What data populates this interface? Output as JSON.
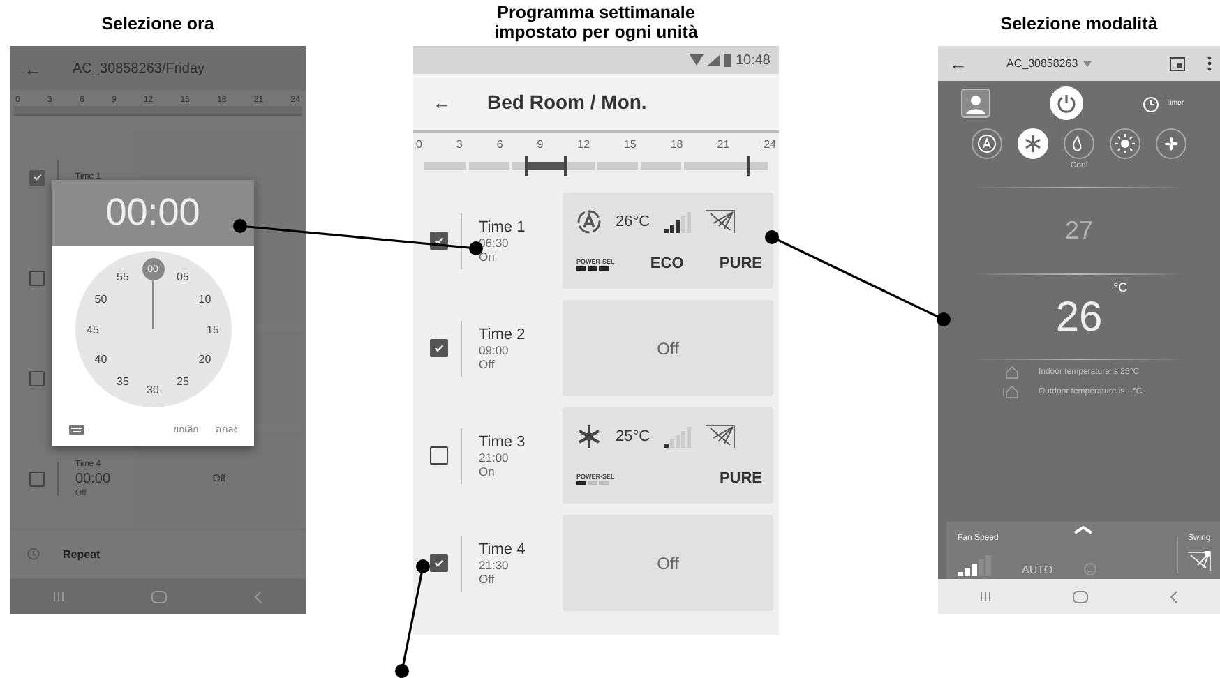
{
  "time_picker_screen": {
    "caption": "Selezione ora",
    "back": "←",
    "title": "AC_30858263/Friday",
    "ticks": [
      "0",
      "3",
      "6",
      "9",
      "12",
      "15",
      "18",
      "21",
      "24"
    ],
    "rows": [
      {
        "checked": true,
        "name": "Time 1"
      },
      {
        "checked": false
      },
      {
        "checked": false
      },
      {
        "checked": false,
        "name": "Time 4",
        "time": "00:00",
        "state": "Off",
        "setting": "Off"
      }
    ],
    "repeat": "Repeat",
    "dialog": {
      "time": "00:00",
      "minutes": [
        {
          "label": "00",
          "selected": true
        },
        {
          "label": "05",
          "selected": false
        },
        {
          "label": "10",
          "selected": false
        },
        {
          "label": "15",
          "selected": false
        },
        {
          "label": "20",
          "selected": false
        },
        {
          "label": "25",
          "selected": false
        },
        {
          "label": "30",
          "selected": false
        },
        {
          "label": "35",
          "selected": false
        },
        {
          "label": "40",
          "selected": false
        },
        {
          "label": "45",
          "selected": false
        },
        {
          "label": "50",
          "selected": false
        },
        {
          "label": "55",
          "selected": false
        }
      ],
      "cancel": "ยกเลิก",
      "ok": "ตกลง"
    }
  },
  "schedule_screen": {
    "caption": "Programma settimanale impostato per ogni unità",
    "status_time": "10:48",
    "back": "←",
    "title": "Bed Room / Mon.",
    "ticks": [
      "0",
      "3",
      "6",
      "9",
      "12",
      "15",
      "18",
      "21",
      "24"
    ],
    "rows": [
      {
        "checked": true,
        "name": "Time 1",
        "time": "06:30",
        "state": "On",
        "setting": {
          "kind": "program",
          "mode_icon": {
            "kind": "auto"
          },
          "temperature": "26°C",
          "fan": {
            "level": 0.6
          },
          "power_sel": {
            "label": "POWER-SEL",
            "level": 1
          },
          "options": [
            "ECO",
            "PURE"
          ]
        }
      },
      {
        "checked": true,
        "name": "Time 2",
        "time": "09:00",
        "state": "Off",
        "setting": {
          "kind": "off",
          "label": "Off"
        }
      },
      {
        "checked": false,
        "name": "Time 3",
        "time": "21:00",
        "state": "On",
        "setting": {
          "kind": "program",
          "mode_icon": {
            "kind": "cool"
          },
          "temperature": "25°C",
          "fan": {
            "level": 0.2
          },
          "power_sel": {
            "label": "POWER-SEL",
            "level": 0.33
          },
          "options": [
            "PURE"
          ]
        }
      },
      {
        "checked": true,
        "name": "Time 4",
        "time": "21:30",
        "state": "Off",
        "setting": {
          "kind": "off",
          "label": "Off"
        }
      }
    ]
  },
  "mode_screen": {
    "caption": "Selezione modalità",
    "back": "←",
    "title": "AC_30858263",
    "timer": "Timer",
    "modes": [
      {
        "kind": "auto",
        "selected": false
      },
      {
        "kind": "cool",
        "selected": true
      },
      {
        "kind": "dry",
        "selected": false
      },
      {
        "kind": "heat",
        "selected": false
      },
      {
        "kind": "fan",
        "selected": false
      }
    ],
    "mode_label": "Cool",
    "temp_above": "27",
    "temperature": "26",
    "unit": "°C",
    "indoor": "Indoor temperature is 25°C",
    "outdoor": "Outdoor temperature is --°C",
    "fan_speed": {
      "label": "Fan Speed",
      "level": 0.6,
      "value": "AUTO"
    },
    "swing": "Swing"
  }
}
